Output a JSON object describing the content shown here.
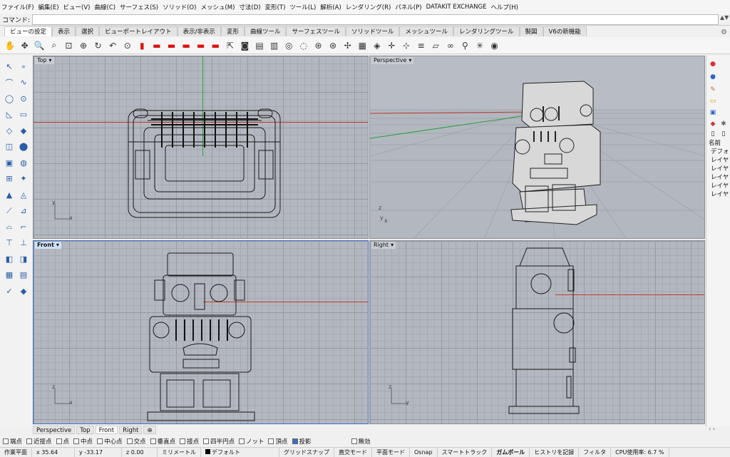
{
  "menu": [
    "ファイル(F)",
    "編集(E)",
    "ビュー(V)",
    "曲線(C)",
    "サーフェス(S)",
    "ソリッド(O)",
    "メッシュ(M)",
    "寸法(D)",
    "変形(T)",
    "ツール(L)",
    "解析(A)",
    "レンダリング(R)",
    "パネル(P)",
    "DATAKIT EXCHANGE",
    "ヘルプ(H)"
  ],
  "command": {
    "label": "コマンド:",
    "value": ""
  },
  "tabs": [
    "ビューの設定",
    "表示",
    "選択",
    "ビューポートレイアウト",
    "表示/非表示",
    "変形",
    "曲線ツール",
    "サーフェスツール",
    "ソリッドツール",
    "メッシュツール",
    "レンダリングツール",
    "製図",
    "V6の新機能"
  ],
  "viewports": {
    "top": {
      "label": "Top"
    },
    "perspective": {
      "label": "Perspective"
    },
    "front": {
      "label": "Front"
    },
    "right": {
      "label": "Right"
    }
  },
  "axes": {
    "top": [
      "y",
      "x"
    ],
    "persp": [
      "z",
      "y",
      "x"
    ],
    "front": [
      "z",
      "x"
    ],
    "right": [
      "z",
      "y"
    ]
  },
  "viewport_tabs": [
    "Perspective",
    "Top",
    "Front",
    "Right"
  ],
  "osnaps": [
    {
      "label": "端点",
      "checked": false
    },
    {
      "label": "近接点",
      "checked": false
    },
    {
      "label": "点",
      "checked": false
    },
    {
      "label": "中点",
      "checked": false
    },
    {
      "label": "中心点",
      "checked": false
    },
    {
      "label": "交点",
      "checked": false
    },
    {
      "label": "垂直点",
      "checked": false
    },
    {
      "label": "接点",
      "checked": false
    },
    {
      "label": "四半円点",
      "checked": false
    },
    {
      "label": "ノット",
      "checked": false
    },
    {
      "label": "頂点",
      "checked": false
    },
    {
      "label": "投影",
      "checked": true
    },
    {
      "label": "無効",
      "checked": false
    }
  ],
  "status": {
    "plane": "作業平面",
    "x": "x 35.64",
    "y": "y -33.17",
    "z": "z 0.00",
    "unit": "ミリメートル",
    "layer": "デフォルト",
    "items": [
      "グリッドスナップ",
      "直交モード",
      "平面モード",
      "Osnap",
      "スマートトラック",
      "ガムボール",
      "ヒストリを記録",
      "フィルタ",
      "CPU使用率: 6.7 %"
    ]
  },
  "layers": {
    "header": "名前",
    "items": [
      "デフォ",
      "レイヤ",
      "レイヤ",
      "レイヤ",
      "レイヤ",
      "レイヤ"
    ]
  },
  "toolbar_icons": [
    "hand-icon",
    "move-icon",
    "zoom-icon",
    "zoom-extents-icon",
    "zoom-window-icon",
    "zoom-selected-icon",
    "rotate-icon",
    "undo-view-icon",
    "named-view-icon",
    "redcar-icon",
    "car-icon",
    "car-icon",
    "car-icon",
    "car-icon",
    "car-icon",
    "set-view-icon",
    "camera-icon",
    "print-icon",
    "save-view-icon",
    "render-icon",
    "lens-icon",
    "target-icon",
    "target-icon",
    "grid-icon",
    "box-icon",
    "cube-icon",
    "gumball-icon",
    "axes-icon",
    "align-icon",
    "plane-icon",
    "link-icon",
    "walk-icon",
    "sun-icon",
    "compass-icon"
  ]
}
